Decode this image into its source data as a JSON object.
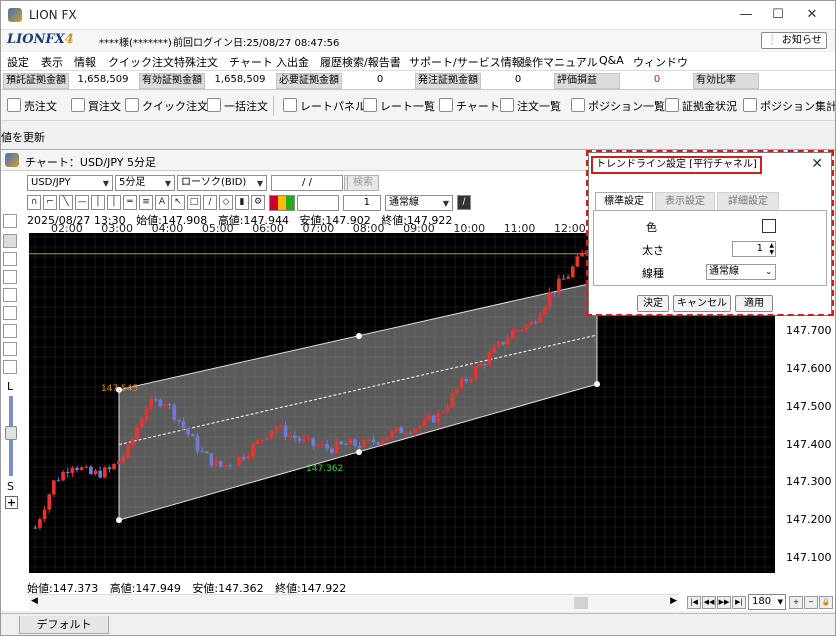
{
  "window": {
    "title": "LION FX",
    "controls": [
      "—",
      "☐",
      "✕"
    ]
  },
  "header": {
    "logo": "LIONFX",
    "logo_num": "4",
    "user": "****様(*******)",
    "last_login": "前回ログイン日:25/08/27 08:47:56",
    "notice": "お知らせ"
  },
  "menu": [
    "設定",
    "表示",
    "情報",
    "クイック注文",
    "特殊注文",
    "チャート",
    "入出金",
    "履歴検索/報告書",
    "サポート/サービス情報",
    "操作マニュアル",
    "Q&A",
    "ウィンドウ"
  ],
  "account": {
    "items": [
      {
        "label": "預託証拠金額",
        "value": "1,658,509"
      },
      {
        "label": "有効証拠金額",
        "value": "1,658,509"
      },
      {
        "label": "必要証拠金額",
        "value": "0"
      },
      {
        "label": "発注証拠金額",
        "value": "0"
      },
      {
        "label": "評価損益",
        "value": "0"
      },
      {
        "label": "有効比率",
        "value": ""
      }
    ]
  },
  "toolbar": [
    "売注文",
    "買注文",
    "クイック注文",
    "一括注文",
    "レートパネル",
    "レート一覧",
    "チャート",
    "注文一覧",
    "ポジション一覧",
    "証拠金状況",
    "ポジション集計"
  ],
  "refresh_label": "値を更新",
  "chart_window": {
    "title": "チャート：USD/JPY 5分足",
    "symbol": "USD/JPY",
    "timeframe": "5分足",
    "chart_kind": "ローソク(BID)",
    "date_placeholder": "/ /",
    "search_label": "検索",
    "line_width": "1",
    "line_style": "通常線",
    "header_ohlc": [
      "2025/08/27 13:30",
      "始値:147.908",
      "高値:147.944",
      "安値:147.902",
      "終値:147.922"
    ],
    "footer_ohlc": [
      "始値:147.373",
      "高値:147.949",
      "安値:147.362",
      "終値:147.922"
    ],
    "side_labels": [
      "L",
      "S"
    ],
    "zoom": "180",
    "tab": "デフォルト"
  },
  "chart_data": {
    "type": "candlestick",
    "title": "",
    "x_ticks": [
      "02:00",
      "03:00",
      "04:00",
      "05:00",
      "06:00",
      "07:00",
      "08:00",
      "09:00",
      "10:00",
      "11:00",
      "12:00"
    ],
    "y_ticks": [
      147.8,
      147.7,
      147.6,
      147.5,
      147.4,
      147.3,
      147.2,
      147.1
    ],
    "ylim": [
      147.06,
      147.96
    ],
    "annotations": [
      {
        "text": "147.545"
      },
      {
        "text": "147.362"
      }
    ],
    "close_path": [
      147.18,
      147.3,
      147.35,
      147.32,
      147.33,
      147.38,
      147.5,
      147.52,
      147.45,
      147.38,
      147.34,
      147.36,
      147.4,
      147.45,
      147.42,
      147.4,
      147.39,
      147.4,
      147.4,
      147.42,
      147.44,
      147.45,
      147.48,
      147.55,
      147.6,
      147.65,
      147.7,
      147.72,
      147.8,
      147.85,
      147.92
    ],
    "channel": {
      "upper_start": 147.545,
      "upper_end": 147.83,
      "middle_start": 147.4,
      "middle_end": 147.69,
      "lower_start": 147.2,
      "lower_end": 147.56
    },
    "hline": 147.905,
    "grid": true
  },
  "dialog": {
    "title": "トレンドライン設定 [平行チャネル]",
    "close": "✕",
    "tabs": [
      "標準設定",
      "表示設定",
      "詳細設定"
    ],
    "color_label": "色",
    "width_label": "太さ",
    "width_value": "1",
    "style_label": "線種",
    "style_value": "通常線",
    "buttons": [
      "決定",
      "キャンセル",
      "適用"
    ]
  },
  "colors": {
    "accent_red": "#d31c1c",
    "candle_up": "#e8342e",
    "candle_down": "#6f7bd8",
    "hline": "#e08a1e"
  }
}
